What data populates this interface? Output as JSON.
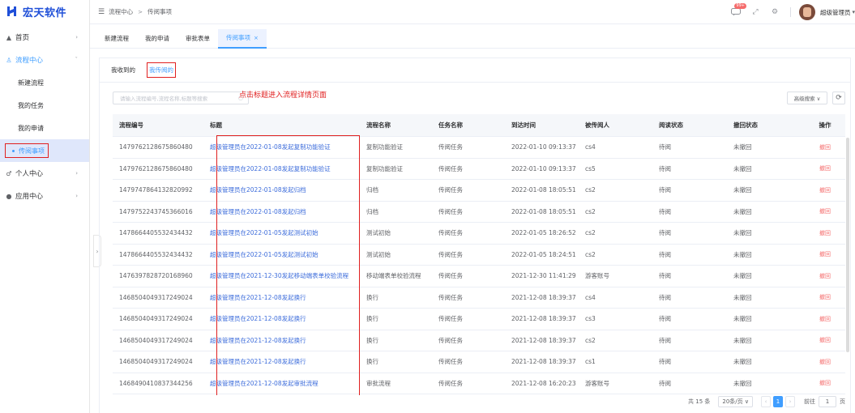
{
  "logo": {
    "text": "宏天软件"
  },
  "sidebar": {
    "items": [
      {
        "icon": "▲",
        "label": "首页",
        "arrow": "›"
      },
      {
        "icon": "♙",
        "label": "流程中心",
        "arrow": "ˇ"
      },
      {
        "icon": "♂",
        "label": "个人中心",
        "arrow": "›"
      },
      {
        "icon": "●",
        "label": "应用中心",
        "arrow": "›"
      }
    ],
    "sub_items": [
      "新建流程",
      "我的任务",
      "我的申请",
      "传阅事项"
    ]
  },
  "header": {
    "breadcrumb": [
      "流程中心",
      "传阅事项"
    ],
    "crumb_sep": ">",
    "badge": "99+",
    "user_name": "超级管理员"
  },
  "tabs": [
    {
      "label": "新建流程"
    },
    {
      "label": "我的申请"
    },
    {
      "label": "审批表单"
    },
    {
      "label": "传阅事项",
      "close": "×"
    }
  ],
  "subtabs": [
    "我收到的",
    "我传阅的"
  ],
  "search": {
    "placeholder": "请输入流程编号,流程名称,标题等搜索"
  },
  "annotation": "点击标题进入流程详情页面",
  "toolbar": {
    "advanced_search": "高级搜索 ∨",
    "refresh": "⟳"
  },
  "table": {
    "headers": [
      "流程编号",
      "标题",
      "流程名称",
      "任务名称",
      "到达时间",
      "被传阅人",
      "阅读状态",
      "撤回状态",
      "操作"
    ],
    "rows": [
      [
        "1479762128675860480",
        "超级管理员在2022-01-08发起复制功能验证",
        "复制功能验证",
        "传阅任务",
        "2022-01-10 09:13:37",
        "cs4",
        "待阅",
        "未撤回",
        "撤回"
      ],
      [
        "1479762128675860480",
        "超级管理员在2022-01-08发起复制功能验证",
        "复制功能验证",
        "传阅任务",
        "2022-01-10 09:13:37",
        "cs5",
        "待阅",
        "未撤回",
        "撤回"
      ],
      [
        "1479747864132820992",
        "超级管理员在2022-01-08发起归档",
        "归档",
        "传阅任务",
        "2022-01-08 18:05:51",
        "cs2",
        "待阅",
        "未撤回",
        "撤回"
      ],
      [
        "1479752243745366016",
        "超级管理员在2022-01-08发起归档",
        "归档",
        "传阅任务",
        "2022-01-08 18:05:51",
        "cs2",
        "待阅",
        "未撤回",
        "撤回"
      ],
      [
        "1478664405532434432",
        "超级管理员在2022-01-05发起测试初始",
        "测试初始",
        "传阅任务",
        "2022-01-05 18:26:52",
        "cs2",
        "待阅",
        "未撤回",
        "撤回"
      ],
      [
        "1478664405532434432",
        "超级管理员在2022-01-05发起测试初始",
        "测试初始",
        "传阅任务",
        "2022-01-05 18:24:51",
        "cs2",
        "待阅",
        "未撤回",
        "撤回"
      ],
      [
        "1476397828720168960",
        "超级管理员在2021-12-30发起移动端表单校验流程",
        "移动端表单校验流程",
        "传阅任务",
        "2021-12-30 11:41:29",
        "游客账号",
        "待阅",
        "未撤回",
        "撤回"
      ],
      [
        "1468504049317249024",
        "超级管理员在2021-12-08发起换行",
        "换行",
        "传阅任务",
        "2021-12-08 18:39:37",
        "cs4",
        "待阅",
        "未撤回",
        "撤回"
      ],
      [
        "1468504049317249024",
        "超级管理员在2021-12-08发起换行",
        "换行",
        "传阅任务",
        "2021-12-08 18:39:37",
        "cs3",
        "待阅",
        "未撤回",
        "撤回"
      ],
      [
        "1468504049317249024",
        "超级管理员在2021-12-08发起换行",
        "换行",
        "传阅任务",
        "2021-12-08 18:39:37",
        "cs2",
        "待阅",
        "未撤回",
        "撤回"
      ],
      [
        "1468504049317249024",
        "超级管理员在2021-12-08发起换行",
        "换行",
        "传阅任务",
        "2021-12-08 18:39:37",
        "cs1",
        "待阅",
        "未撤回",
        "撤回"
      ],
      [
        "1468490410837344256",
        "超级管理员在2021-12-08发起审批流程",
        "审批流程",
        "传阅任务",
        "2021-12-08 16:20:23",
        "游客账号",
        "待阅",
        "未撤回",
        "撤回"
      ]
    ]
  },
  "pager": {
    "total": "共 15 条",
    "size": "20条/页 ∨",
    "prev": "‹",
    "current": "1",
    "next": "›",
    "goto": "前往",
    "page": "1",
    "page_suffix": "页"
  },
  "colors": {
    "accent": "#409eff",
    "brand": "#1f4fd8",
    "highlight": "#e02020",
    "danger": "#f56c6c"
  }
}
